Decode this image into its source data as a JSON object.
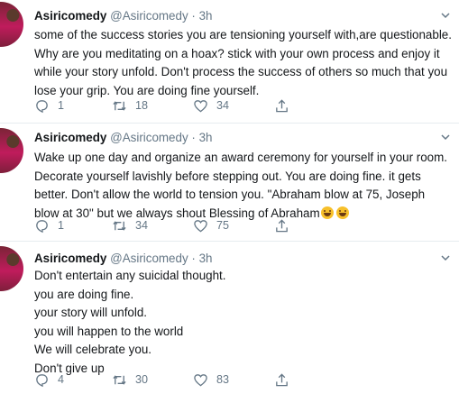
{
  "tweets": [
    {
      "name": "Asiricomedy",
      "handle": "@Asiricomedy",
      "separator": "·",
      "time": "3h",
      "lines": [
        "some of the success stories you are tensioning yourself with,are questionable.",
        "Why are you meditating on a hoax? stick with your own process and enjoy it",
        "while your story unfold. Don't process the success of others so much that you",
        "lose your grip. You are doing fine yourself."
      ],
      "replies": "1",
      "retweets": "18",
      "likes": "34"
    },
    {
      "name": "Asiricomedy",
      "handle": "@Asiricomedy",
      "separator": "·",
      "time": "3h",
      "lines": [
        "Wake up one day and organize an award ceremony for yourself in your room.",
        "Decorate yourself lavishly before stepping out. You are doing fine. it gets",
        "better. Don't allow the world to tension you. \"Abraham blow at 75, Joseph",
        "blow at 30\" but we always shout Blessing of Abraham"
      ],
      "replies": "1",
      "retweets": "34",
      "likes": "75"
    },
    {
      "name": "Asiricomedy",
      "handle": "@Asiricomedy",
      "separator": "·",
      "time": "3h",
      "lines": [
        "Don't entertain any suicidal thought.",
        "you are doing fine.",
        "your story will unfold.",
        "you will happen to the world",
        "We will celebrate you.",
        "Don't give up"
      ],
      "replies": "4",
      "retweets": "30",
      "likes": "83"
    }
  ]
}
